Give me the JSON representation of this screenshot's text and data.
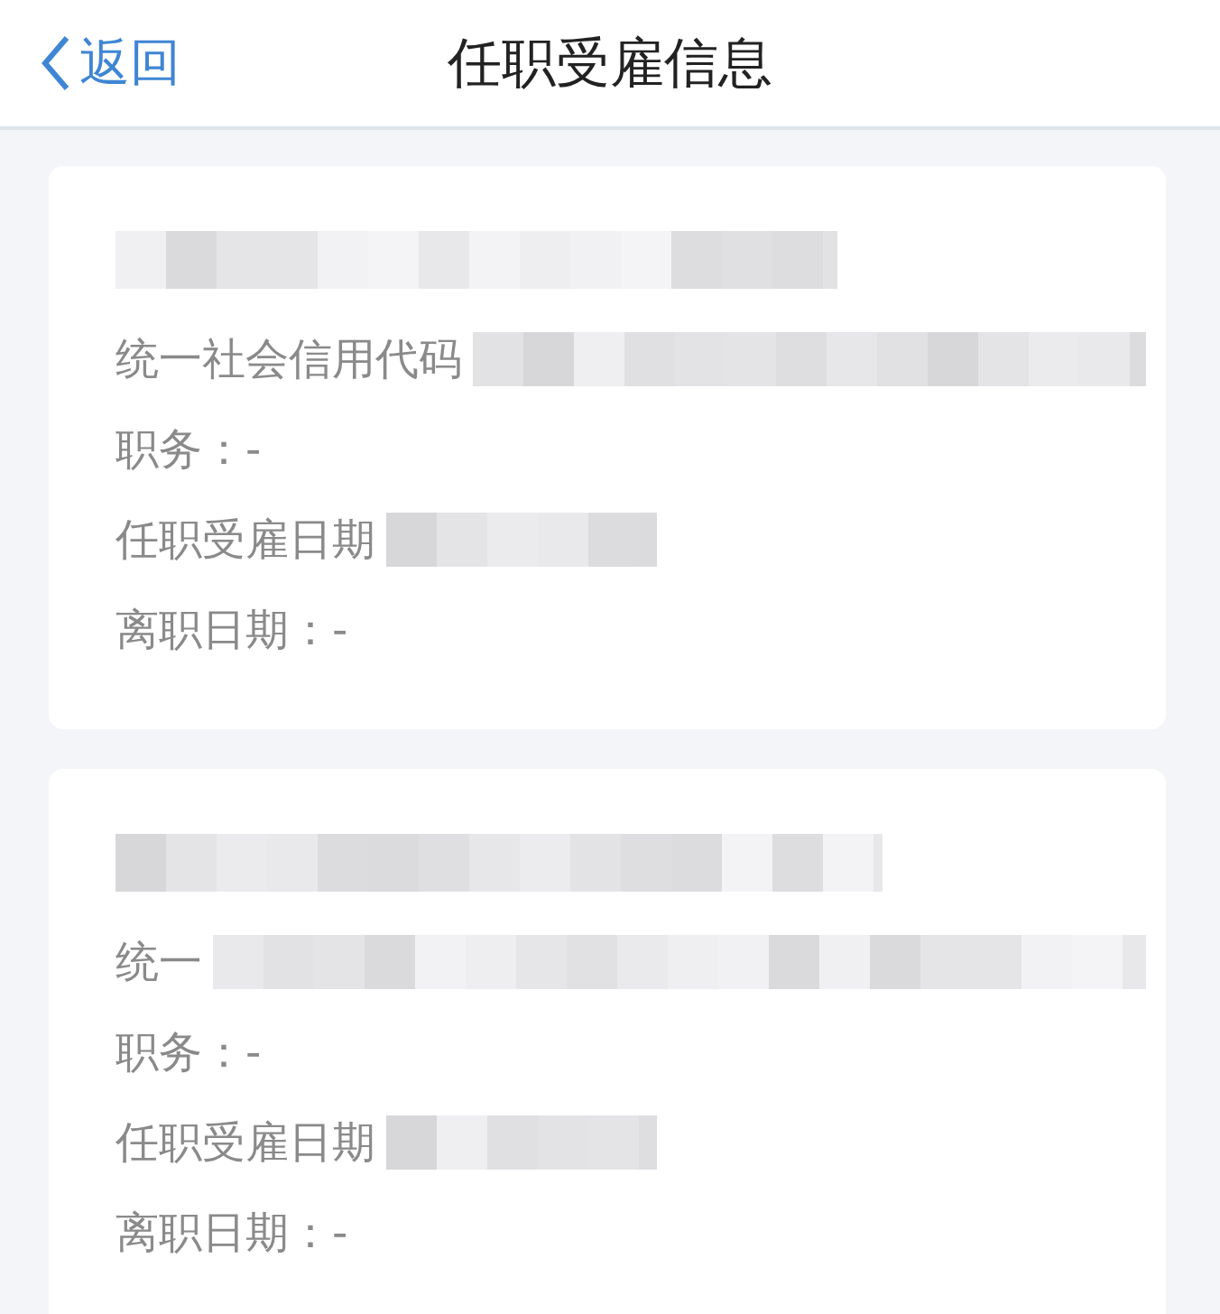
{
  "nav_bar": {
    "back": "返回",
    "title": "任职受雇信息"
  },
  "cards": [
    {
      "title_redacted": true,
      "rows": [
        {
          "label": "统一社会信用代码",
          "redacted": true
        },
        {
          "label": "职务：-",
          "redacted": false
        },
        {
          "label": "任职受雇日期",
          "redacted": true
        },
        {
          "label": "离职日期：-",
          "redacted": false
        }
      ]
    },
    {
      "title_redacted": true,
      "rows": [
        {
          "label": "统一",
          "redacted": true
        },
        {
          "label": "职务：-",
          "redacted": false
        },
        {
          "label": "任职受雇日期",
          "redacted": true
        },
        {
          "label": "离职日期：-",
          "redacted": false
        }
      ]
    }
  ]
}
